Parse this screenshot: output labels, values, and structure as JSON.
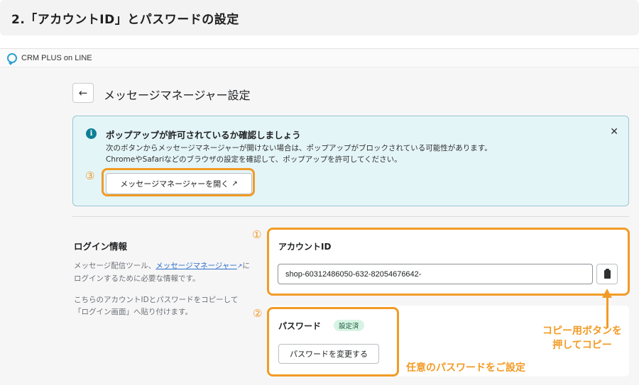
{
  "heading": "2.「アカウントID」とパスワードの設定",
  "app": {
    "name": "CRM PLUS on LINE"
  },
  "page": {
    "back_icon": "←",
    "title": "メッセージマネージャー設定"
  },
  "banner": {
    "info_icon": "i",
    "title": "ポップアップが許可されているか確認しましょう",
    "body": "次のボタンからメッセージマネージャーが開けない場合は、ポップアップがブロックされている可能性があります。\nChromeやSafariなどのブラウザの設定を確認して、ポップアップを許可してください。",
    "close_icon": "✕",
    "open_button_label": "メッセージマネージャーを開く",
    "external_icon": "↗"
  },
  "login": {
    "title": "ログイン情報",
    "desc_prefix": "メッセージ配信ツール、",
    "desc_link": "メッセージマネージャー",
    "desc_suffix": "にログインするために必要な情報です。",
    "desc2": "こちらのアカウントIDとパスワードをコピーして\n「ログイン画面」へ貼り付けます。"
  },
  "account": {
    "label": "アカウントID",
    "value": "shop-60312486050-632-82054676642-"
  },
  "password": {
    "label": "パスワード",
    "badge": "設定済",
    "change_button_label": "パスワードを変更する"
  },
  "annotations": {
    "n1": "①",
    "n2": "②",
    "n3": "③",
    "copy_note_line1": "コピー用ボタンを",
    "copy_note_line2": "押してコピー",
    "password_note": "任意のパスワードをご設定"
  },
  "colors": {
    "accent_orange": "#f29b26",
    "link_blue": "#2c6ecb",
    "banner_bg": "#e4f5f8"
  }
}
